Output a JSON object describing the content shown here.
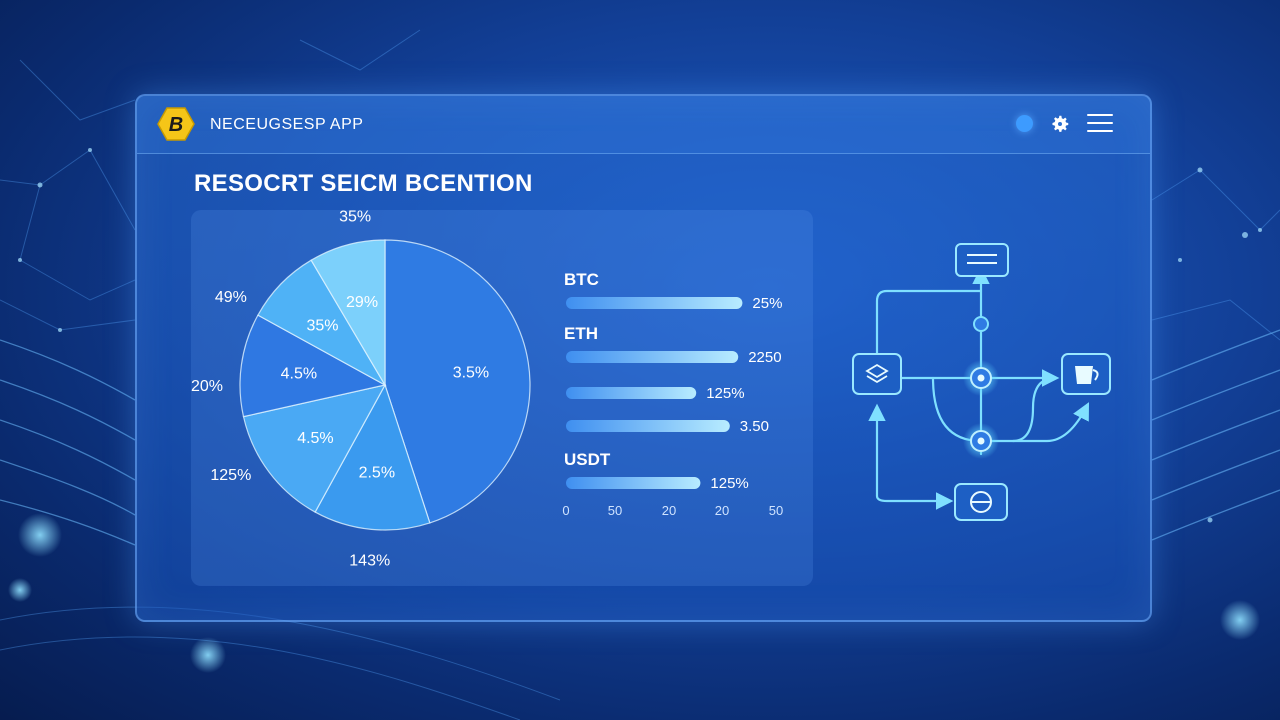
{
  "app": {
    "title": "NECEUGSESP APP",
    "logo_letter": "B",
    "logo_color": "#f5c518"
  },
  "titlebar_icons": [
    "status-dot-icon",
    "gear-icon",
    "hamburger-menu-icon"
  ],
  "section": {
    "title": "RESOCRT SEICM BCENTION"
  },
  "chart_data": [
    {
      "type": "pie",
      "slice_labels": [
        "3.5%",
        "2.5%",
        "4.5%",
        "4.5%",
        "35%",
        "29%"
      ],
      "outer_labels": [
        "35%",
        "49%",
        "20%",
        "125%",
        "143%"
      ],
      "slices": [
        {
          "label": "3.5%",
          "value": 0.45,
          "color": "#2f7be3"
        },
        {
          "label": "2.5%",
          "value": 0.13,
          "color": "#3a9aef"
        },
        {
          "label": "4.5%",
          "value": 0.135,
          "color": "#4aa9f4"
        },
        {
          "label": "4.5%",
          "value": 0.115,
          "color": "#2f78e2"
        },
        {
          "label": "35%",
          "value": 0.085,
          "color": "#4fb2f6"
        },
        {
          "label": "29%",
          "value": 0.085,
          "color": "#7cd0fb"
        }
      ]
    },
    {
      "type": "bar",
      "orientation": "horizontal",
      "categories": [
        "BTC",
        "ETH",
        "",
        "",
        "USDT"
      ],
      "values": [
        42,
        41,
        31,
        39,
        32
      ],
      "value_labels": [
        "25%",
        "2250",
        "125%",
        "3.50",
        "125%"
      ],
      "xticks": [
        "0",
        "50",
        "20",
        "20",
        "50"
      ],
      "xlim": [
        0,
        50
      ],
      "bar_gradient": [
        "#3f8ff0",
        "#b8ecff"
      ]
    }
  ],
  "flow_diagram": {
    "nodes": [
      "menu-box-icon",
      "layers-icon",
      "cup-icon",
      "globe-icon"
    ],
    "accent": "#5fd3ff"
  }
}
